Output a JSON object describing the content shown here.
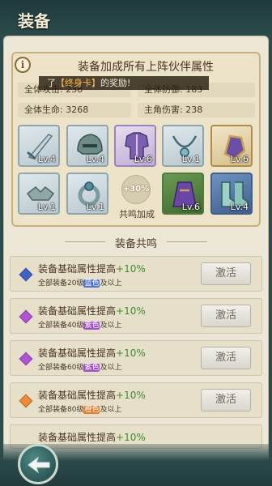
{
  "header": {
    "title": "装备"
  },
  "info": {
    "title": "装备加成所有上阵伙伴属性",
    "icon": "info-icon",
    "stats": [
      {
        "label": "全体攻击: 238"
      },
      {
        "label": "全体防御: 183"
      },
      {
        "label": "全体生命: 3268"
      },
      {
        "label": "主角伤害: 238"
      }
    ],
    "toast": {
      "prefix": "了",
      "item": "【终身卡】",
      "suffix": "的奖励!"
    }
  },
  "equipment": [
    {
      "name": "sword-icon",
      "level": "Lv.4",
      "rarity": "common"
    },
    {
      "name": "helmet-icon",
      "level": "Lv.4",
      "rarity": "common"
    },
    {
      "name": "armor-icon",
      "level": "Lv.6",
      "rarity": "purple"
    },
    {
      "name": "necklace-icon",
      "level": "Lv.1",
      "rarity": "common"
    },
    {
      "name": "gauntlet-icon",
      "level": "Lv.6",
      "rarity": "gold"
    },
    {
      "name": "bracer-icon",
      "level": "Lv.1",
      "rarity": "common"
    },
    {
      "name": "ring-icon",
      "level": "Lv.1",
      "rarity": "common"
    },
    {
      "name": "robe-icon",
      "level": "Lv.6",
      "rarity": "green"
    },
    {
      "name": "boots-icon",
      "level": "Lv.4",
      "rarity": "blue"
    }
  ],
  "bonus": {
    "value": "+30%",
    "label": "共鸣加成"
  },
  "resonance": {
    "title": "装备共鸣",
    "items": [
      {
        "title": "装备基础属性提高",
        "plus": "+10%",
        "sub_prefix": "全部装备20级",
        "quality": "蓝色",
        "sub_suffix": "及以上",
        "button": "激活",
        "gem_color": "#3f63c9",
        "quality_color": "#4f6fd8"
      },
      {
        "title": "装备基础属性提高",
        "plus": "+10%",
        "sub_prefix": "全部装备40级",
        "quality": "紫色",
        "sub_suffix": "及以上",
        "button": "激活",
        "gem_color": "#b052d6",
        "quality_color": "#a24fd0"
      },
      {
        "title": "装备基础属性提高",
        "plus": "+10%",
        "sub_prefix": "全部装备60级",
        "quality": "紫色",
        "sub_suffix": "及以上",
        "button": "激活",
        "gem_color": "#b052d6",
        "quality_color": "#a24fd0"
      },
      {
        "title": "装备基础属性提高",
        "plus": "+10%",
        "sub_prefix": "全部装备80级",
        "quality": "橙色",
        "sub_suffix": "及以上",
        "button": "激活",
        "gem_color": "#ec8a3a",
        "quality_color": "#e57f2a"
      },
      {
        "title": "装备基础属性提高",
        "plus": "+10%"
      }
    ]
  },
  "footer": {
    "back_icon": "back-arrow-icon"
  }
}
